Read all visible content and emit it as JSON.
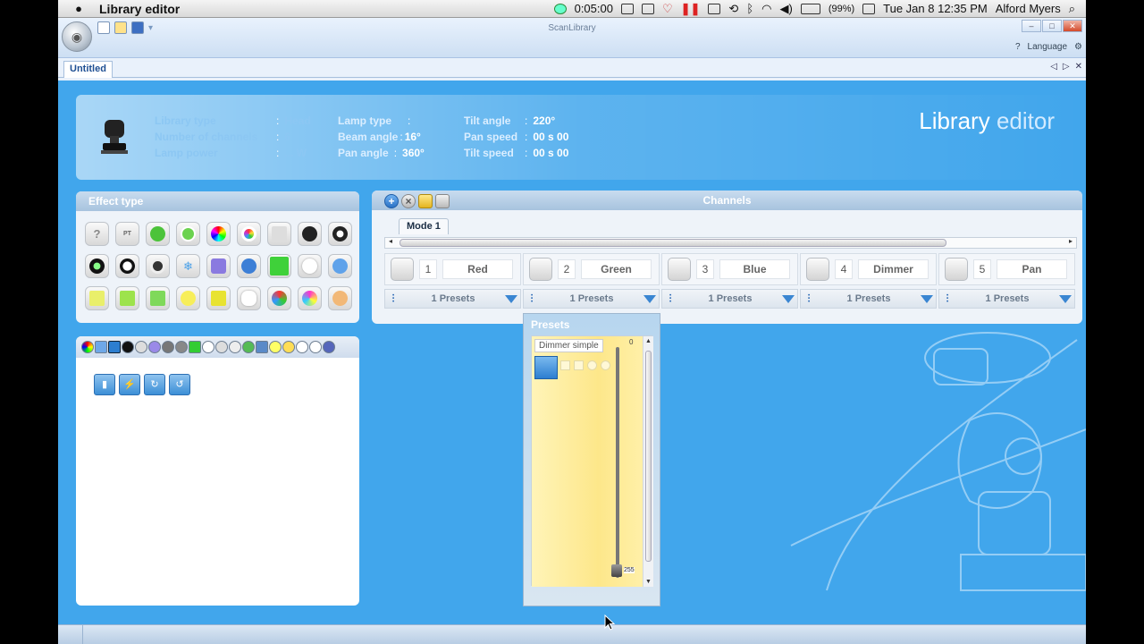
{
  "menubar": {
    "app_name": "Library editor",
    "timer": "0:05:00",
    "battery": "(99%)",
    "clock": "Tue Jan 8  12:35 PM",
    "user": "Alford Myers"
  },
  "window": {
    "title": "ScanLibrary",
    "help": "?",
    "language": "Language",
    "doc_tab": "Untitled"
  },
  "info": {
    "labels": {
      "library_type": "Library type",
      "channels": "Number of channels",
      "lamp_power": "Lamp power",
      "lamp_type": "Lamp type",
      "beam_angle": "Beam angle",
      "pan_angle": "Pan angle",
      "tilt_angle": "Tilt angle",
      "pan_speed": "Pan speed",
      "tilt_speed": "Tilt speed"
    },
    "values": {
      "library_type": "Head",
      "channels": "6",
      "lamp_power": "... W",
      "lamp_type": "",
      "beam_angle": "16°",
      "pan_angle": "360°",
      "tilt_angle": "220°",
      "pan_speed": "00 s 00",
      "tilt_speed": "00 s 00"
    },
    "title_main": "Library",
    "title_sub": "editor"
  },
  "effect_panel": {
    "title": "Effect type"
  },
  "channels_panel": {
    "title": "Channels",
    "mode_tab": "Mode 1",
    "channels": [
      {
        "num": "1",
        "name": "Red",
        "presets": "1 Presets"
      },
      {
        "num": "2",
        "name": "Green",
        "presets": "1 Presets"
      },
      {
        "num": "3",
        "name": "Blue",
        "presets": "1 Presets"
      },
      {
        "num": "4",
        "name": "Dimmer",
        "presets": "1 Presets"
      },
      {
        "num": "5",
        "name": "Pan",
        "presets": "1 Presets"
      }
    ]
  },
  "presets_popup": {
    "title": "Presets",
    "preset_name": "Dimmer simple",
    "min": "0",
    "max": "255"
  },
  "colors": {
    "background": "#41a6ec",
    "accent": "#2c7ed0",
    "preset_bg": "#fde78a"
  }
}
